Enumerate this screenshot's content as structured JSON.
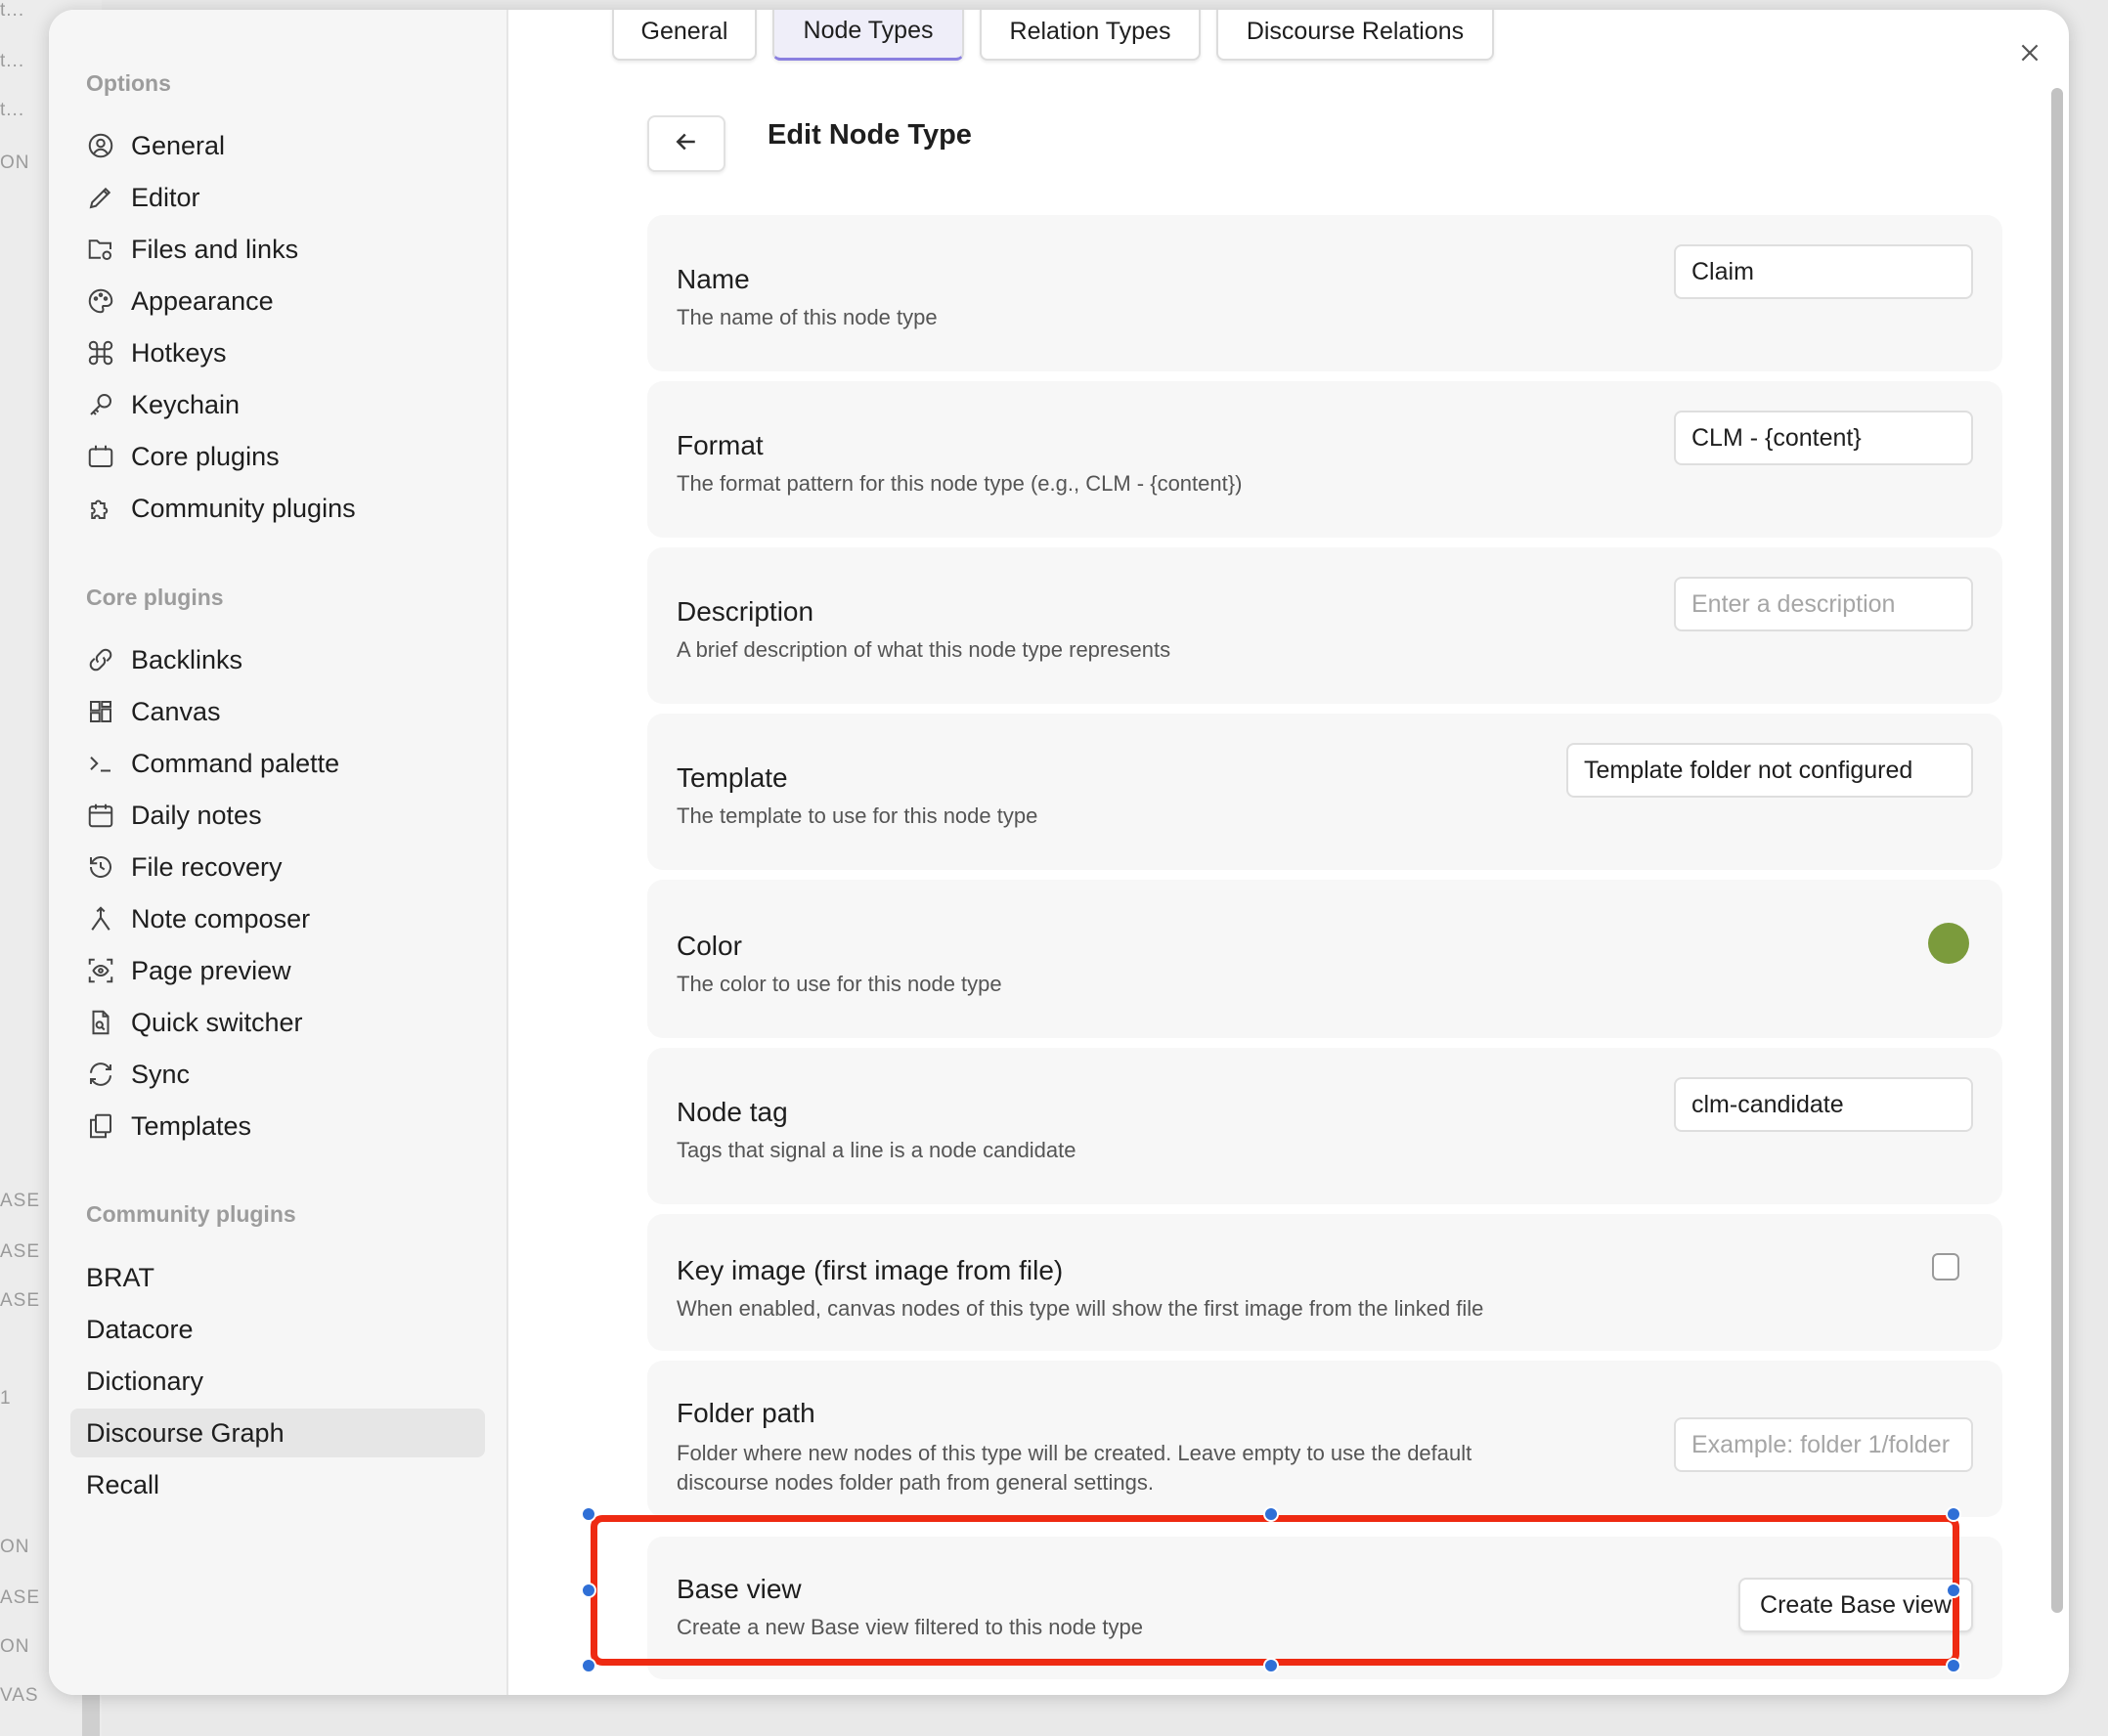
{
  "background": {
    "labels": [
      "t...",
      "t...",
      "t...",
      "ON",
      "ASE",
      "ASE",
      "ASE",
      "1",
      "ON",
      "ASE",
      "ON",
      "VAS"
    ]
  },
  "sidebar": {
    "options_heading": "Options",
    "options": [
      {
        "label": "General",
        "icon": "user-circle-icon"
      },
      {
        "label": "Editor",
        "icon": "pencil-icon"
      },
      {
        "label": "Files and links",
        "icon": "folder-cog-icon"
      },
      {
        "label": "Appearance",
        "icon": "palette-icon"
      },
      {
        "label": "Hotkeys",
        "icon": "command-icon"
      },
      {
        "label": "Keychain",
        "icon": "key-icon"
      },
      {
        "label": "Core plugins",
        "icon": "calendar-plug-icon"
      },
      {
        "label": "Community plugins",
        "icon": "puzzle-icon"
      }
    ],
    "core_heading": "Core plugins",
    "core": [
      {
        "label": "Backlinks",
        "icon": "link-search-icon"
      },
      {
        "label": "Canvas",
        "icon": "layout-grid-icon"
      },
      {
        "label": "Command palette",
        "icon": "terminal-icon"
      },
      {
        "label": "Daily notes",
        "icon": "calendar-icon"
      },
      {
        "label": "File recovery",
        "icon": "history-icon"
      },
      {
        "label": "Note composer",
        "icon": "merge-icon"
      },
      {
        "label": "Page preview",
        "icon": "scan-eye-icon"
      },
      {
        "label": "Quick switcher",
        "icon": "file-search-icon"
      },
      {
        "label": "Sync",
        "icon": "sync-icon"
      },
      {
        "label": "Templates",
        "icon": "copy-icon"
      }
    ],
    "community_heading": "Community plugins",
    "community": [
      "BRAT",
      "Datacore",
      "Dictionary",
      "Discourse Graph",
      "Recall"
    ],
    "active_item": "Discourse Graph"
  },
  "tabs": [
    "General",
    "Node Types",
    "Relation Types",
    "Discourse Relations"
  ],
  "active_tab": "Node Types",
  "page_title": "Edit Node Type",
  "fields": {
    "name": {
      "label": "Name",
      "desc": "The name of this node type",
      "value": "Claim"
    },
    "format": {
      "label": "Format",
      "desc": "The format pattern for this node type (e.g., CLM - {content})",
      "value": "CLM - {content}"
    },
    "description": {
      "label": "Description",
      "desc": "A brief description of what this node type represents",
      "placeholder": "Enter a description"
    },
    "template": {
      "label": "Template",
      "desc": "The template to use for this node type",
      "value": "Template folder not configured"
    },
    "color": {
      "label": "Color",
      "desc": "The color to use for this node type",
      "value": "#7b9b3c"
    },
    "node_tag": {
      "label": "Node tag",
      "desc": "Tags that signal a line is a node candidate",
      "value": "clm-candidate"
    },
    "key_image": {
      "label": "Key image (first image from file)",
      "desc": "When enabled, canvas nodes of this type will show the first image from the linked file",
      "checked": false
    },
    "folder_path": {
      "label": "Folder path",
      "desc_line1": "Folder where new nodes of this type will be created. Leave empty to use the default",
      "desc_line2": "discourse nodes folder path from general settings.",
      "placeholder": "Example: folder 1/folder"
    },
    "base_view": {
      "label": "Base view",
      "desc": "Create a new Base view filtered to this node type",
      "button": "Create Base view"
    }
  },
  "colors": {
    "highlight": "#ee2a12",
    "handle": "#2f6fd6",
    "accent": "#8a7fe0"
  }
}
